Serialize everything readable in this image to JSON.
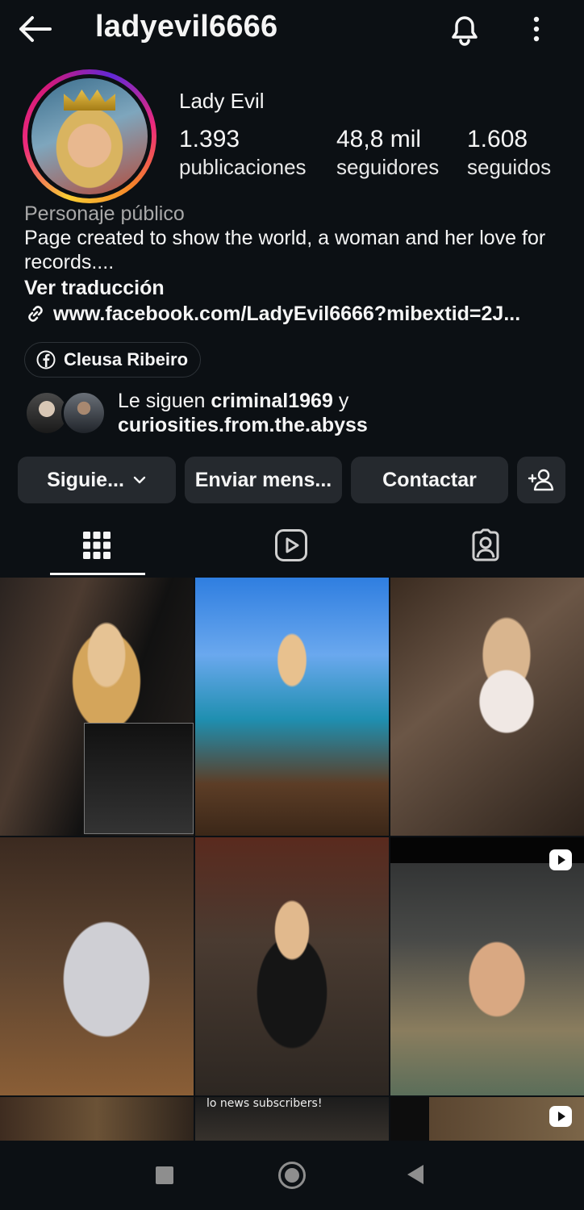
{
  "header": {
    "username": "ladyevil6666",
    "back_icon": "arrow-left-icon",
    "bell_icon": "bell-icon",
    "more_icon": "more-vertical-icon"
  },
  "profile": {
    "display_name": "Lady Evil",
    "stats": [
      {
        "value": "1.393",
        "label": "publicaciones"
      },
      {
        "value": "48,8 mil",
        "label": "seguidores"
      },
      {
        "value": "1.608",
        "label": "seguidos"
      }
    ],
    "category": "Personaje público",
    "bio": "Page created to show the world, a woman and her love for records....",
    "translate": "Ver traducción",
    "link": "www.facebook.com/LadyEvil6666?mibextid=2J...",
    "facebook_chip": "Cleusa Ribeiro"
  },
  "followed_by": {
    "prefix": "Le siguen ",
    "user1": "criminal1969",
    "joiner": " y",
    "user2": "curiosities.from.the.abyss"
  },
  "actions": {
    "following": "Siguie...",
    "message": "Enviar mens...",
    "contact": "Contactar"
  },
  "grid": {
    "cell8_caption": "lo news subscribers!"
  },
  "colors": {
    "background": "#0c1014",
    "button": "#25292e",
    "secondary_text": "#a8a8a8"
  }
}
